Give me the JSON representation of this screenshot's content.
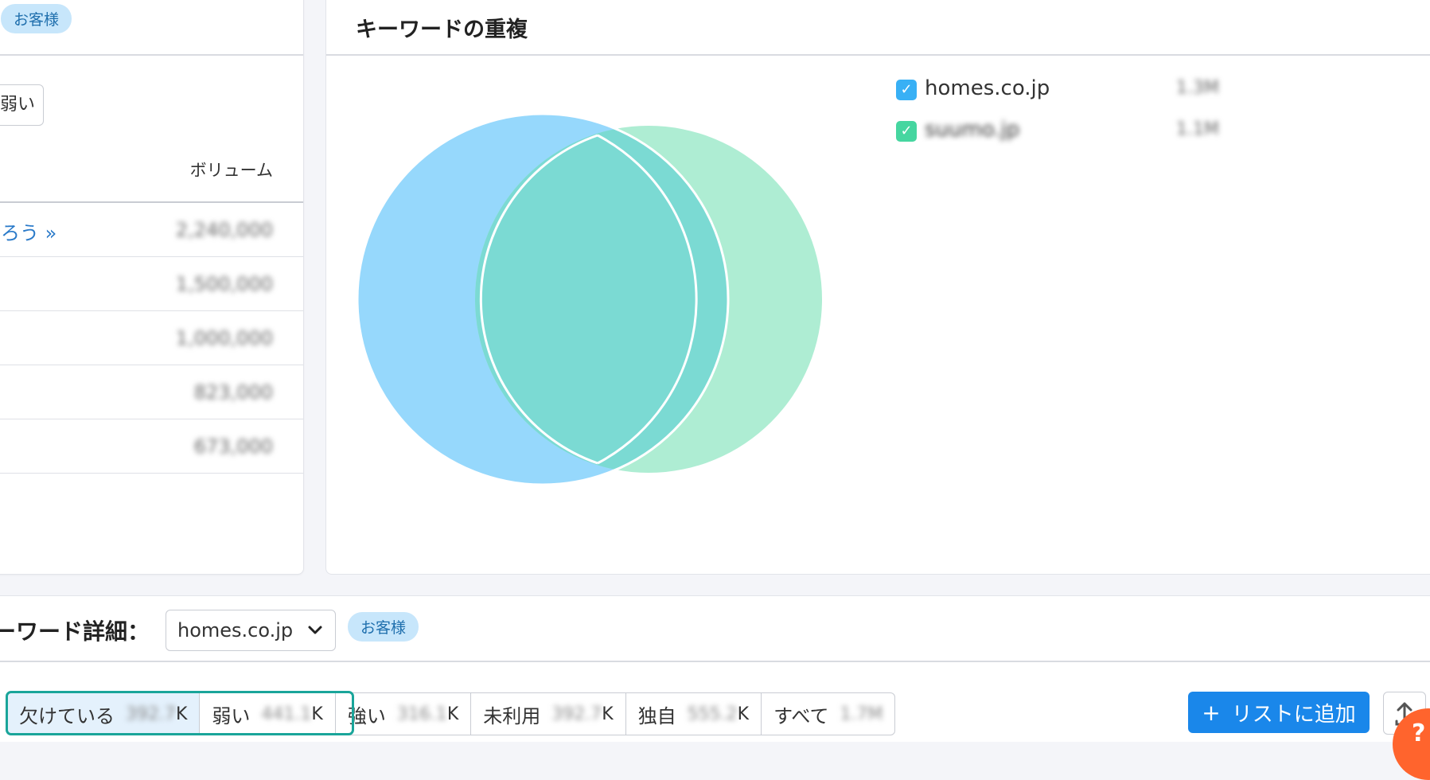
{
  "left_panel": {
    "badge": "お客様",
    "weak_button": "弱い",
    "volume_header": "ボリューム",
    "first_keyword_fragment": "ろう »",
    "volumes": [
      "2,240,000",
      "1,500,000",
      "1,000,000",
      "823,000",
      "673,000"
    ]
  },
  "overlap_panel": {
    "title": "キーワードの重複",
    "legend": [
      {
        "name": "homes.co.jp",
        "count": "1.3M",
        "color": "#38b0f5"
      },
      {
        "name": "suumo.jp",
        "count": "1.1M",
        "color": "#46d6a0"
      }
    ],
    "venn_colors": {
      "left": "#96d8fc",
      "right": "#aeedd3",
      "overlap": "#7bdad3"
    }
  },
  "details": {
    "title": "ーワード詳細：",
    "domain": "homes.co.jp",
    "badge": "お客様",
    "tabs": [
      {
        "label": "欠けている",
        "count_blur": "392.7",
        "suffix": "K"
      },
      {
        "label": "弱い",
        "count_blur": "441.1",
        "suffix": "K"
      },
      {
        "label": "強い",
        "count_blur": "316.1",
        "suffix": "K"
      },
      {
        "label": "未利用",
        "count_blur": "392.7",
        "suffix": "K"
      },
      {
        "label": "独自",
        "count_blur": "555.2",
        "suffix": "K"
      },
      {
        "label": "すべて",
        "count_blur": "1.7M",
        "suffix": ""
      }
    ],
    "add_button": "リストに追加",
    "help": "?"
  }
}
